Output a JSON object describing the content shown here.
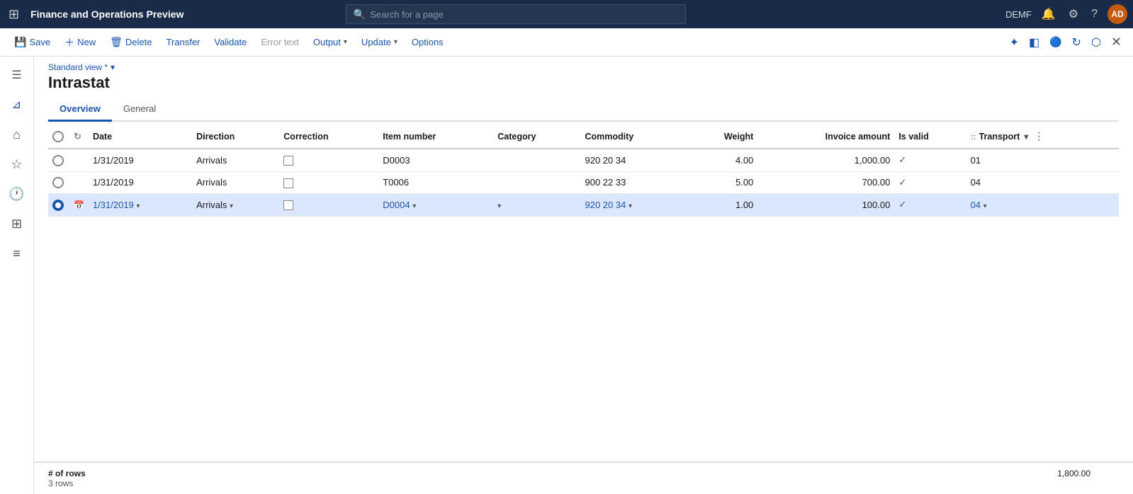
{
  "topnav": {
    "appTitle": "Finance and Operations Preview",
    "searchPlaceholder": "Search for a page",
    "company": "DEMF",
    "avatar": "AD"
  },
  "toolbar": {
    "save": "Save",
    "new": "New",
    "delete": "Delete",
    "transfer": "Transfer",
    "validate": "Validate",
    "errorText": "Error text",
    "output": "Output",
    "update": "Update",
    "options": "Options"
  },
  "sidebar": {
    "icons": [
      "home",
      "star",
      "clock",
      "calendar",
      "list"
    ]
  },
  "page": {
    "viewLabel": "Standard view *",
    "title": "Intrastat"
  },
  "tabs": [
    {
      "label": "Overview",
      "active": true
    },
    {
      "label": "General",
      "active": false
    }
  ],
  "table": {
    "columns": [
      {
        "key": "select",
        "label": ""
      },
      {
        "key": "refresh",
        "label": ""
      },
      {
        "key": "date",
        "label": "Date"
      },
      {
        "key": "direction",
        "label": "Direction"
      },
      {
        "key": "correction",
        "label": "Correction"
      },
      {
        "key": "itemNumber",
        "label": "Item number"
      },
      {
        "key": "category",
        "label": "Category"
      },
      {
        "key": "commodity",
        "label": "Commodity"
      },
      {
        "key": "weight",
        "label": "Weight",
        "align": "right"
      },
      {
        "key": "invoiceAmount",
        "label": "Invoice amount",
        "align": "right"
      },
      {
        "key": "isValid",
        "label": "Is valid"
      },
      {
        "key": "transport",
        "label": ":: Transport"
      }
    ],
    "rows": [
      {
        "id": 1,
        "selected": false,
        "date": "1/31/2019",
        "direction": "Arrivals",
        "correction": false,
        "itemNumber": "D0003",
        "category": "",
        "commodity": "920 20 34",
        "weight": "4.00",
        "invoiceAmount": "1,000.00",
        "isValid": true,
        "transport": "01"
      },
      {
        "id": 2,
        "selected": false,
        "date": "1/31/2019",
        "direction": "Arrivals",
        "correction": false,
        "itemNumber": "T0006",
        "category": "",
        "commodity": "900 22 33",
        "weight": "5.00",
        "invoiceAmount": "700.00",
        "isValid": true,
        "transport": "04"
      },
      {
        "id": 3,
        "selected": true,
        "date": "1/31/2019",
        "direction": "Arrivals",
        "correction": false,
        "itemNumber": "D0004",
        "category": "",
        "commodity": "920 20 34",
        "weight": "1.00",
        "invoiceAmount": "100.00",
        "isValid": true,
        "transport": "04"
      }
    ]
  },
  "footer": {
    "rowsLabel": "# of rows",
    "rowsCount": "3 rows",
    "totalValue": "1,800.00"
  }
}
